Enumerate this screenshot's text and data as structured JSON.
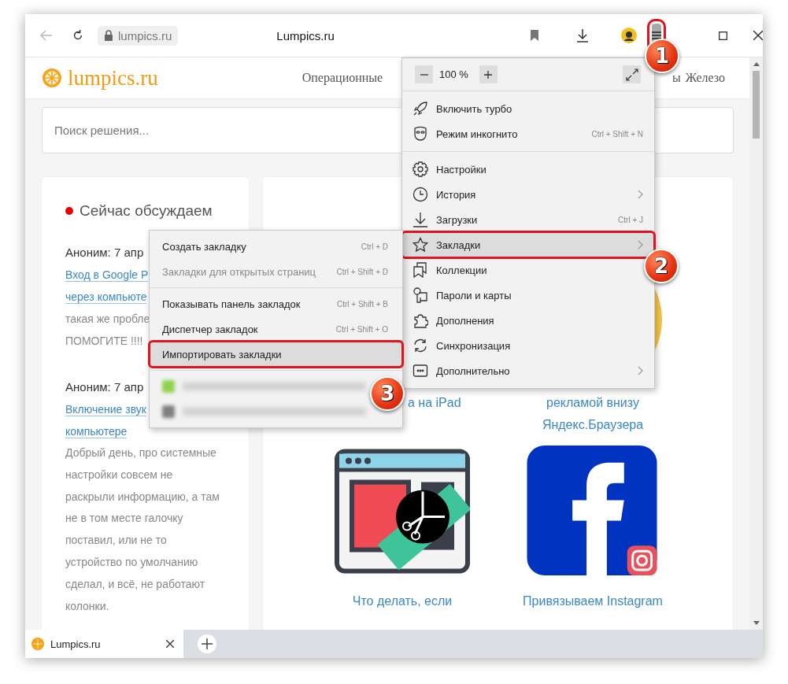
{
  "toolbar": {
    "back_enabled": false,
    "address": "lumpics.ru",
    "title": "Lumpics.ru",
    "menu_open": true
  },
  "site": {
    "logo": "lumpics.ru",
    "nav_left": "Операционные",
    "nav_right": [
      "ы",
      "Железо"
    ],
    "search": {
      "placeholder": "Поиск решения..."
    },
    "sidebar": {
      "title": "Сейчас обсуждаем",
      "comments": [
        {
          "author": "Аноним: 7 апр",
          "link_lines": [
            "Вход в Google P",
            "через компьюте"
          ],
          "text_lines": [
            "такая же пробле",
            "ПОМОГИТЕ !!!!"
          ]
        },
        {
          "author": "Аноним: 7 апр",
          "link_lines": [
            "Включение звук",
            "компьютере"
          ],
          "paragraph": "Добрый день, про системные настройки совсем не раскрыли информацию, а там не в том месте галочку поставил, или не то устройство по умолчанию сделал, и всё, не работают колонки."
        }
      ]
    },
    "articles_top": [
      {
        "lines": [
          "а на iPad"
        ]
      },
      {
        "kind": "round",
        "lines": [
          "рекламой внизу",
          "Яндекс.Браузера"
        ]
      }
    ],
    "articles_bottom": [
      {
        "kind": "window",
        "caption": "Что делать, если"
      },
      {
        "kind": "social",
        "caption": "Привязываем Instagram"
      }
    ]
  },
  "main_menu": {
    "zoom": "100 %",
    "sections": [
      [
        {
          "label": "Включить турбо",
          "submenu": false,
          "selected": false
        },
        {
          "label": "Режим инкогнито",
          "shortcut": "Ctrl + Shift + N",
          "submenu": false,
          "selected": false
        }
      ],
      [
        {
          "label": "Настройки",
          "submenu": false,
          "selected": false
        },
        {
          "label": "История",
          "submenu": true,
          "selected": false
        },
        {
          "label": "Загрузки",
          "shortcut": "Ctrl + J",
          "submenu": false,
          "selected": false
        },
        {
          "label": "Закладки",
          "submenu": true,
          "selected": true
        },
        {
          "label": "Коллекции",
          "submenu": false,
          "selected": false
        },
        {
          "label": "Пароли и карты",
          "submenu": false,
          "selected": false
        },
        {
          "label": "Дополнения",
          "submenu": false,
          "selected": false
        },
        {
          "label": "Синхронизация",
          "submenu": false,
          "selected": false
        },
        {
          "label": "Дополнительно",
          "submenu": true,
          "selected": false
        }
      ]
    ]
  },
  "bookmarks_menu": {
    "sections": [
      [
        {
          "label": "Создать закладку",
          "shortcut": "Ctrl + D",
          "disabled": false,
          "selected": false
        },
        {
          "label": "Закладки для открытых страниц",
          "shortcut": "Ctrl + Shift + D",
          "disabled": true,
          "selected": false
        }
      ],
      [
        {
          "label": "Показывать панель закладок",
          "shortcut": "Ctrl + Shift + B",
          "disabled": false,
          "selected": false
        },
        {
          "label": "Диспетчер закладок",
          "shortcut": "Ctrl + Shift + O",
          "disabled": false,
          "selected": false
        },
        {
          "label": "Импортировать закладки",
          "disabled": false,
          "selected": true
        }
      ]
    ],
    "blurred_items": [
      {
        "color": "#8fd14f"
      },
      {
        "color": "#808080"
      }
    ]
  },
  "badges": [
    {
      "number": "1"
    },
    {
      "number": "2"
    },
    {
      "number": "3"
    }
  ],
  "tabs": [
    {
      "title": "Lumpics.ru",
      "selected": true
    }
  ]
}
